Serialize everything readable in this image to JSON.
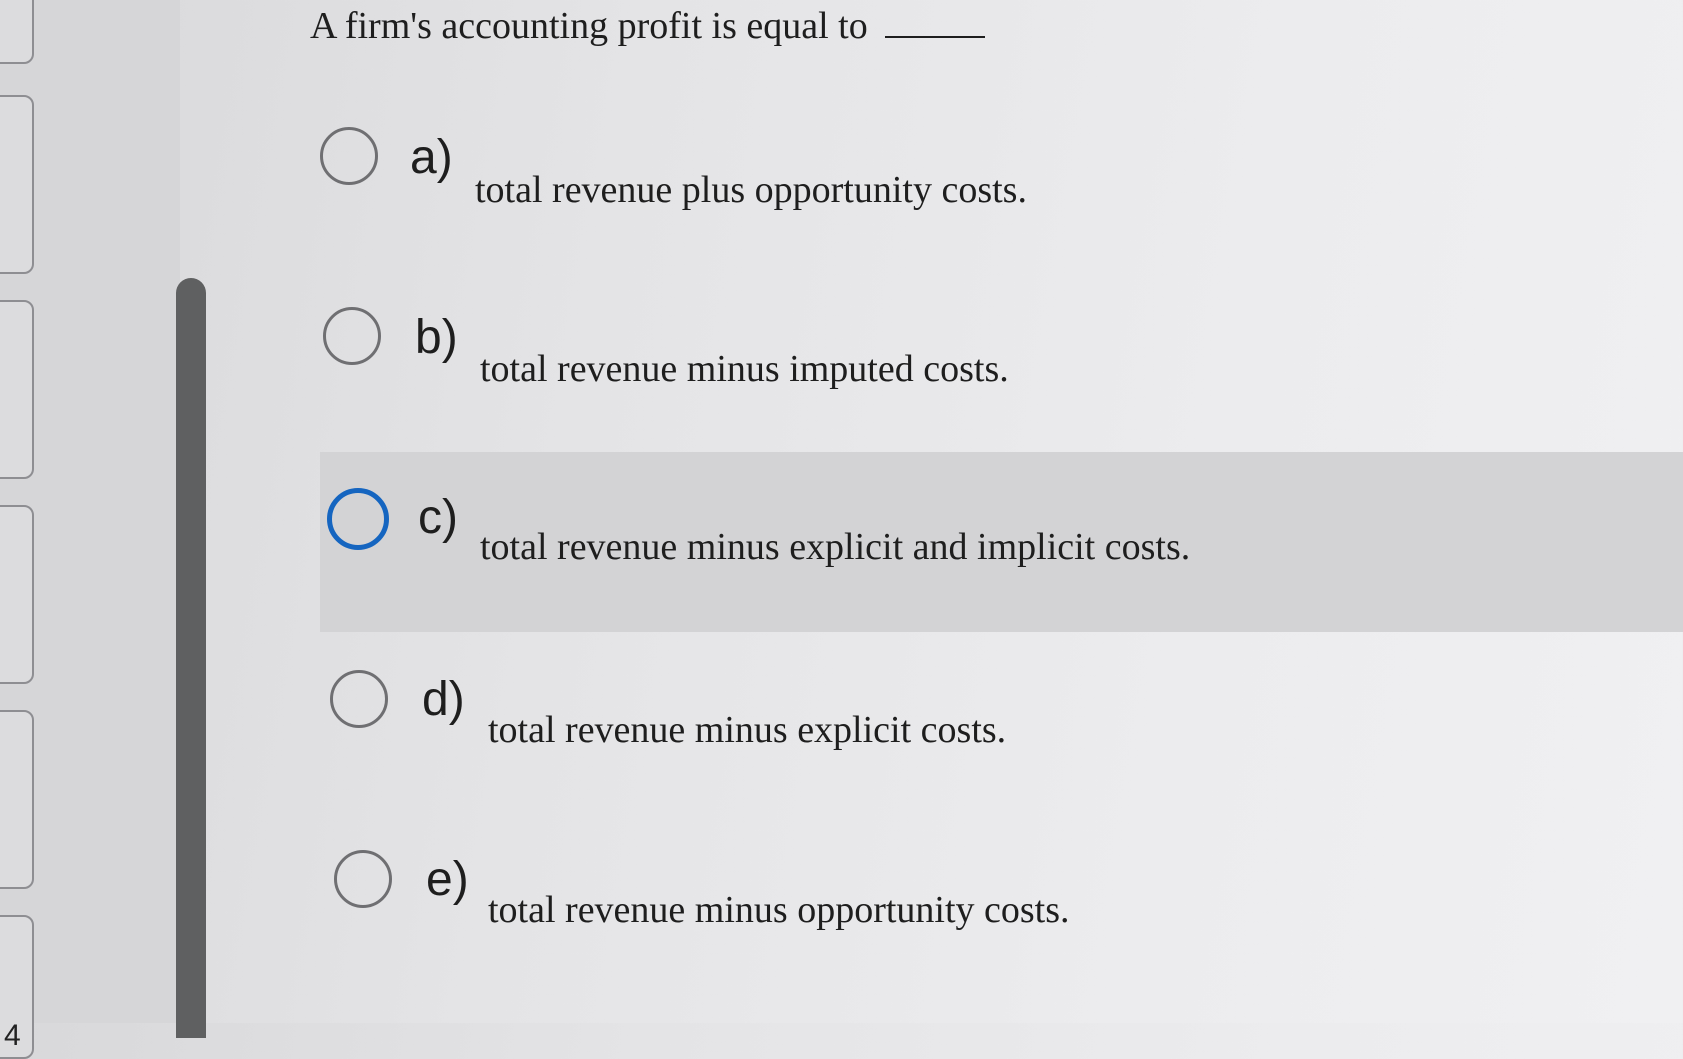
{
  "question": {
    "text": "A firm's accounting profit is equal to"
  },
  "left_nav": {
    "visible_number": "4"
  },
  "options": [
    {
      "letter": "a)",
      "text": "total revenue plus opportunity costs."
    },
    {
      "letter": "b)",
      "text": "total revenue minus imputed costs."
    },
    {
      "letter": "c)",
      "text": "total revenue minus explicit and implicit costs."
    },
    {
      "letter": "d)",
      "text": "total revenue minus explicit costs."
    },
    {
      "letter": "e)",
      "text": "total revenue minus opportunity costs."
    }
  ],
  "colors": {
    "focus_ring": "#1565c0",
    "highlight_row": "#d3d3d5",
    "scrollbar": "#5f6061"
  }
}
